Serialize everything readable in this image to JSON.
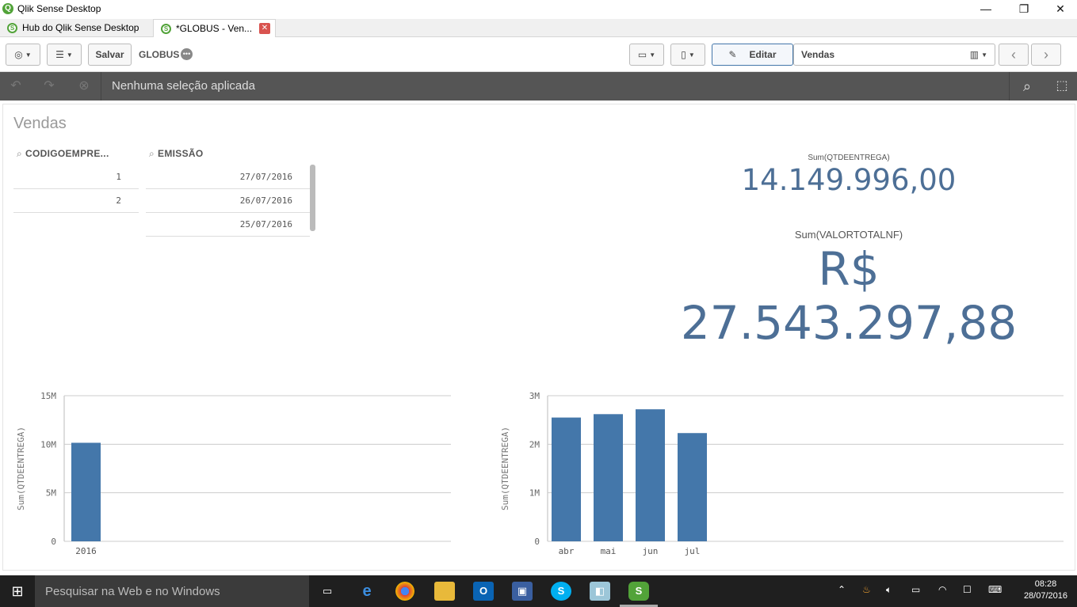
{
  "window": {
    "title": "Qlik Sense Desktop",
    "minimize": "—",
    "restore": "❐",
    "close": "✕"
  },
  "tabs": [
    {
      "label": "Hub do Qlik Sense Desktop"
    },
    {
      "label": "*GLOBUS - Ven..."
    }
  ],
  "toolbar": {
    "save_label": "Salvar",
    "app_name": "GLOBUS",
    "edit_label": "Editar",
    "sheet_name": "Vendas"
  },
  "selections": {
    "status": "Nenhuma seleção aplicada"
  },
  "sheet": {
    "title": "Vendas"
  },
  "filters": [
    {
      "title": "CODIGOEMPRE...",
      "values": [
        "1",
        "2"
      ]
    },
    {
      "title": "EMISSÃO",
      "values": [
        "27/07/2016",
        "26/07/2016",
        "25/07/2016"
      ]
    }
  ],
  "kpis": [
    {
      "label": "Sum(QTDEENTREGA)",
      "value": "14.149.996,00"
    },
    {
      "label": "Sum(VALORTOTALNF)",
      "value": "R$ 27.543.297,88"
    }
  ],
  "chart_data": [
    {
      "type": "bar",
      "categories": [
        "2016"
      ],
      "values": [
        10150000
      ],
      "ylabel": "Sum(QTDEENTREGA)",
      "ylim": [
        0,
        15000000
      ],
      "ticks": [
        "0",
        "5M",
        "10M",
        "15M"
      ],
      "tick_values": [
        0,
        5000000,
        10000000,
        15000000
      ],
      "color": "#4477aa",
      "grid": true
    },
    {
      "type": "bar",
      "categories": [
        "abr",
        "mai",
        "jun",
        "jul"
      ],
      "values": [
        2550000,
        2620000,
        2720000,
        2230000
      ],
      "ylabel": "Sum(QTDEENTREGA)",
      "ylim": [
        0,
        3000000
      ],
      "ticks": [
        "0",
        "1M",
        "2M",
        "3M"
      ],
      "tick_values": [
        0,
        1000000,
        2000000,
        3000000
      ],
      "color": "#4477aa",
      "grid": true
    }
  ],
  "taskbar": {
    "search_placeholder": "Pesquisar na Web e no Windows",
    "time": "08:28",
    "date": "28/07/2016"
  }
}
